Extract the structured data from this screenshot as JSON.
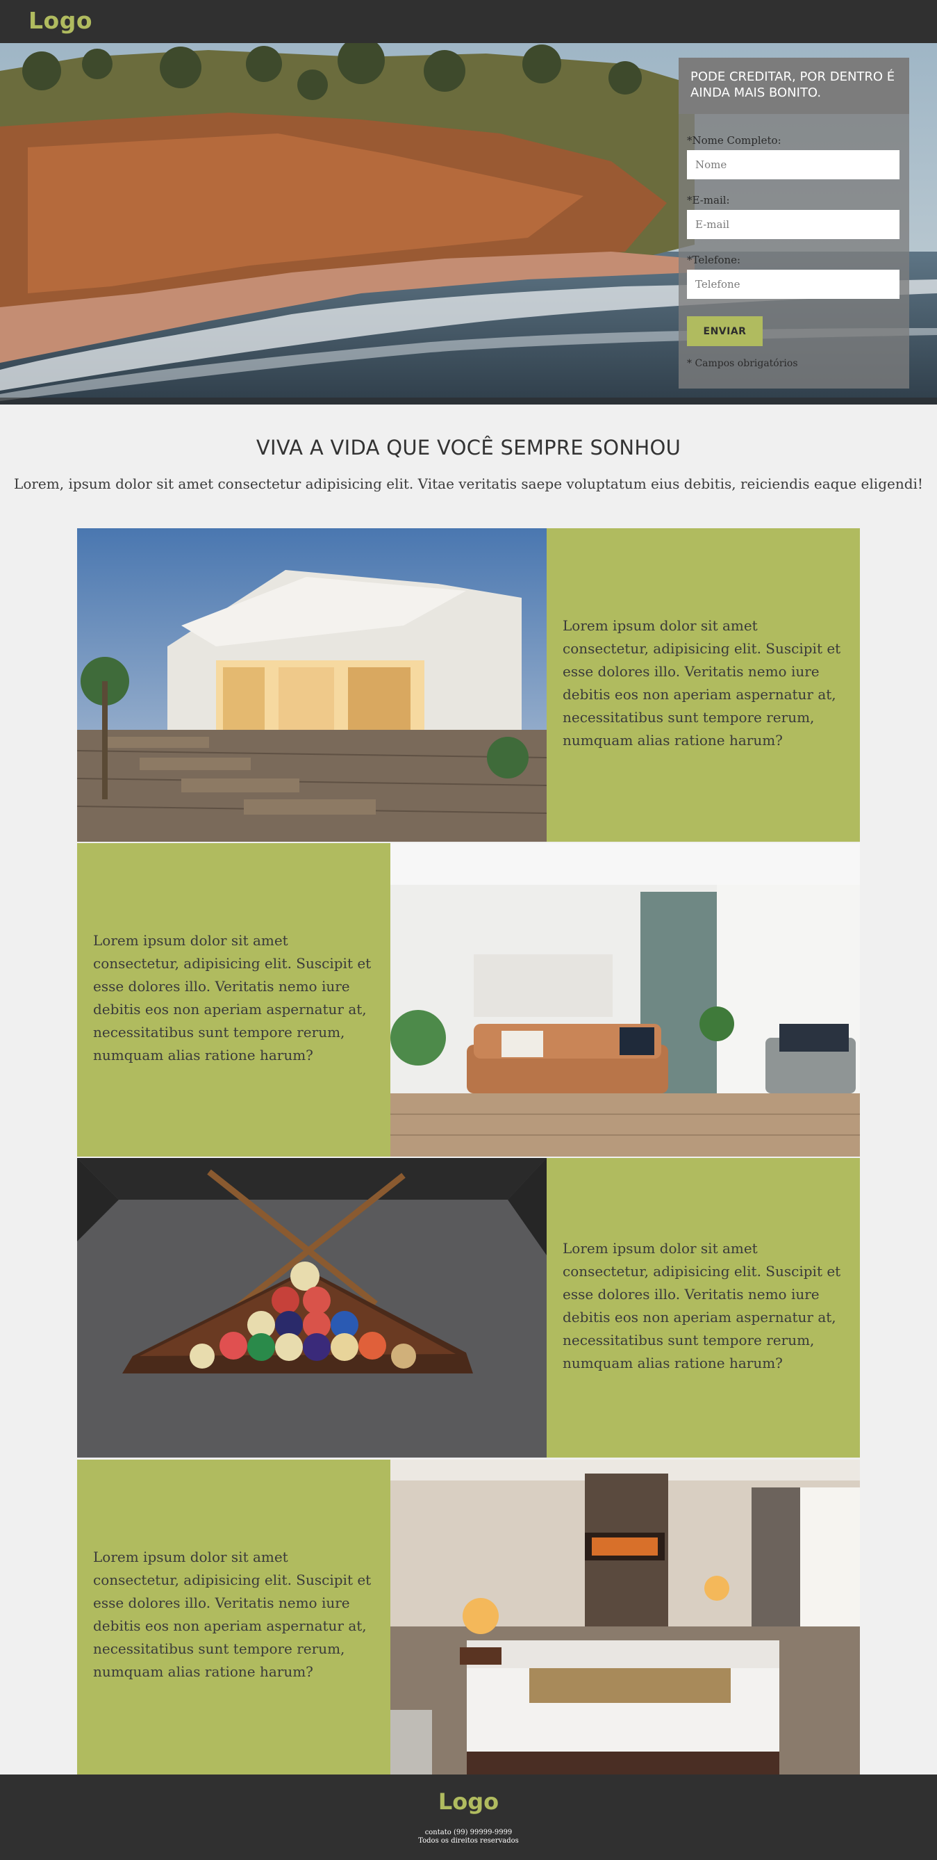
{
  "header": {
    "logo": "Logo"
  },
  "form": {
    "title": "PODE CREDITAR, POR DENTRO É AINDA MAIS BONITO.",
    "name_label": "*Nome Completo:",
    "name_placeholder": "Nome",
    "email_label": "*E-mail:",
    "email_placeholder": "E-mail",
    "phone_label": "*Telefone:",
    "phone_placeholder": "Telefone",
    "submit_label": "ENVIAR",
    "required_note": "* Campos obrigatórios"
  },
  "intro": {
    "headline": "VIVA A VIDA QUE VOCÊ SEMPRE SONHOU",
    "subtitle": "Lorem, ipsum dolor sit amet consectetur adipisicing elit. Vitae veritatis saepe voluptatum eius debitis, reiciendis eaque eligendi!"
  },
  "features": [
    {
      "image": "house-patio-pool",
      "text": "Lorem ipsum dolor sit amet consectetur, adipisicing elit. Suscipit et esse dolores illo. Veritatis nemo iure debitis eos non aperiam aspernatur at, necessitatibus sunt tempore rerum, numquam alias ratione harum?"
    },
    {
      "image": "living-room",
      "text": "Lorem ipsum dolor sit amet consectetur, adipisicing elit. Suscipit et esse dolores illo. Veritatis nemo iure debitis eos non aperiam aspernatur at, necessitatibus sunt tempore rerum, numquam alias ratione harum?"
    },
    {
      "image": "billiard-table",
      "text": "Lorem ipsum dolor sit amet consectetur, adipisicing elit. Suscipit et esse dolores illo. Veritatis nemo iure debitis eos non aperiam aspernatur at, necessitatibus sunt tempore rerum, numquam alias ratione harum?"
    },
    {
      "image": "hotel-bedroom",
      "text": "Lorem ipsum dolor sit amet consectetur, adipisicing elit. Suscipit et esse dolores illo. Veritatis nemo iure debitis eos non aperiam aspernatur at, necessitatibus sunt tempore rerum, numquam alias ratione harum?"
    }
  ],
  "footer": {
    "logo": "Logo",
    "contact": "contato (99) 99999-9999",
    "rights": "Todos os direitos reservados"
  },
  "colors": {
    "accent": "#b0bb5f",
    "dark": "#303030",
    "background": "#f0f0f0"
  }
}
